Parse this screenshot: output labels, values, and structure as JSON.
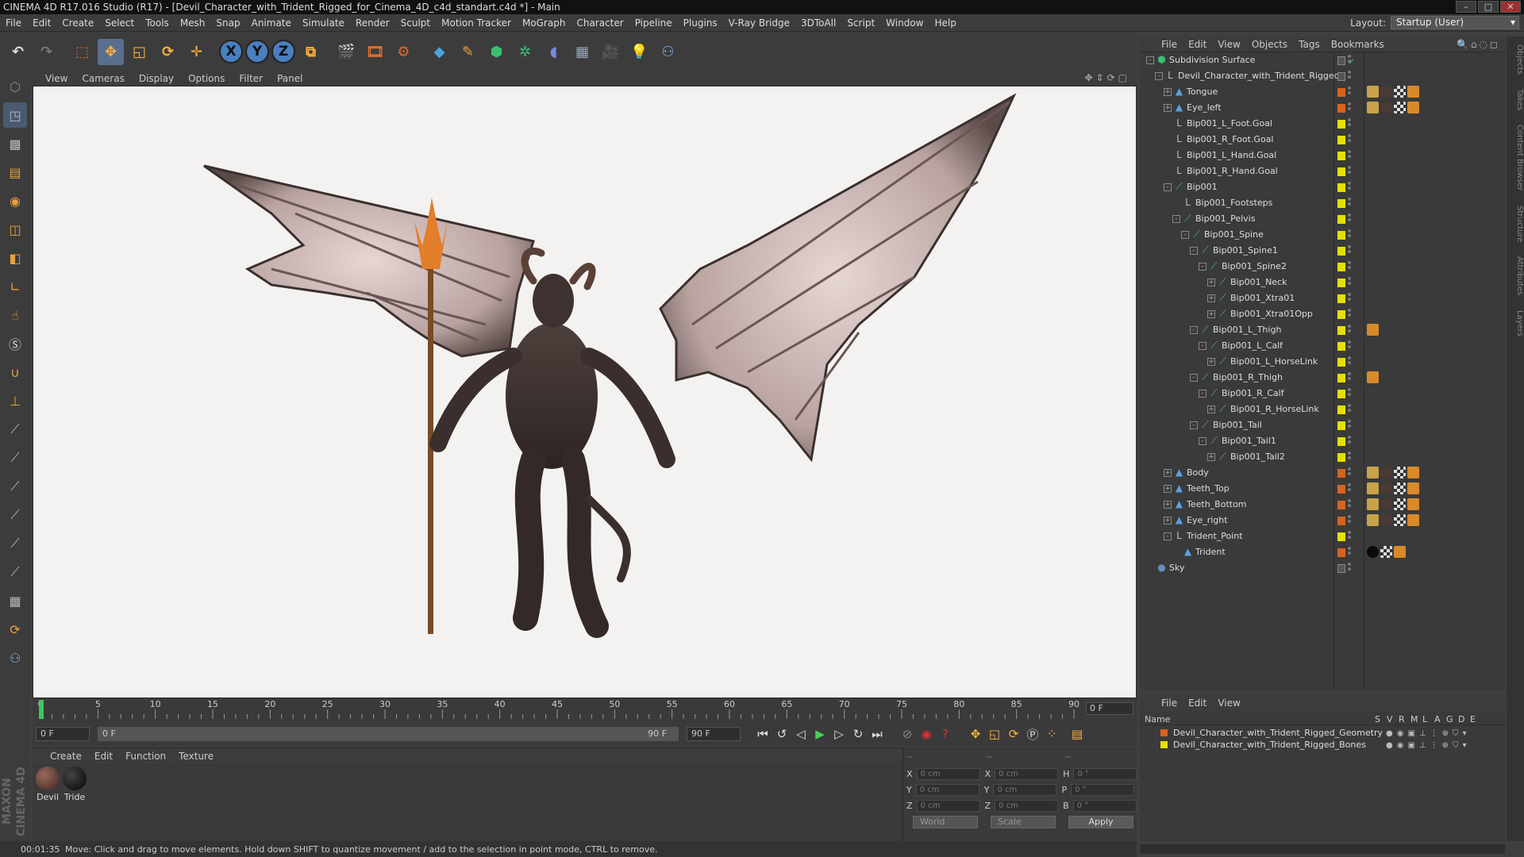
{
  "title": "CINEMA 4D R17.016 Studio (R17) - [Devil_Character_with_Trident_Rigged_for_Cinema_4D_c4d_standart.c4d *] - Main",
  "window_buttons": [
    "–",
    "□",
    "✕"
  ],
  "menu": [
    "File",
    "Edit",
    "Create",
    "Select",
    "Tools",
    "Mesh",
    "Snap",
    "Animate",
    "Simulate",
    "Render",
    "Sculpt",
    "Motion Tracker",
    "MoGraph",
    "Character",
    "Pipeline",
    "Plugins",
    "V-Ray Bridge",
    "3DToAll",
    "Script",
    "Window",
    "Help"
  ],
  "layout": {
    "label": "Layout:",
    "value": "Startup (User)"
  },
  "toolbar_icons": [
    "undo-icon",
    "redo-icon",
    "live-selection-icon",
    "move-icon",
    "scale-icon",
    "rotate-icon",
    "last-tool-icon",
    "x-axis-icon",
    "y-axis-icon",
    "z-axis-icon",
    "coordinate-system-icon",
    "render-view-icon",
    "render-picture-viewer-icon",
    "render-settings-icon",
    "cube-icon",
    "pen-spline-icon",
    "subdivision-icon",
    "array-icon",
    "deformer-icon",
    "floor-icon",
    "camera-icon",
    "light-icon",
    "python-icon"
  ],
  "axis_labels": [
    "X",
    "Y",
    "Z"
  ],
  "viewport_menu": [
    "View",
    "Cameras",
    "Display",
    "Options",
    "Filter",
    "Panel"
  ],
  "timeline": {
    "ticks": [
      "0",
      "5",
      "10",
      "15",
      "20",
      "25",
      "30",
      "35",
      "40",
      "45",
      "50",
      "55",
      "60",
      "65",
      "70",
      "75",
      "80",
      "85",
      "90"
    ],
    "current_frame": "0 F",
    "start_frame": "0 F",
    "range_start": "0 F",
    "range_end": "90 F",
    "end_frame": "90 F"
  },
  "material_menu": [
    "Create",
    "Edit",
    "Function",
    "Texture"
  ],
  "materials": [
    {
      "name": "Devil",
      "color": "#5a3a32"
    },
    {
      "name": "Tride",
      "color": "#0e0e0e"
    }
  ],
  "coords": {
    "headers": [
      "--",
      "--",
      "--"
    ],
    "rows": [
      {
        "a": "X",
        "av": "0 cm",
        "b": "X",
        "bv": "0 cm",
        "c": "H",
        "cv": "0 °"
      },
      {
        "a": "Y",
        "av": "0 cm",
        "b": "Y",
        "bv": "0 cm",
        "c": "P",
        "cv": "0 °"
      },
      {
        "a": "Z",
        "av": "0 cm",
        "b": "Z",
        "bv": "0 cm",
        "c": "B",
        "cv": "0 °"
      }
    ],
    "world": "World",
    "scale": "Scale",
    "apply": "Apply"
  },
  "status": {
    "time": "00:01:35",
    "message": "Move: Click and drag to move elements. Hold down SHIFT to quantize movement / add to the selection in point mode, CTRL to remove."
  },
  "logo": "MAXON CINEMA 4D",
  "object_manager": {
    "menu": [
      "File",
      "Edit",
      "View",
      "Objects",
      "Tags",
      "Bookmarks"
    ],
    "objects": [
      {
        "name": "Subdivision Surface",
        "depth": 0,
        "expand": "-",
        "icon": "subdivision",
        "color": "",
        "tags": [
          "check"
        ]
      },
      {
        "name": "Devil_Character_with_Trident_Rigged",
        "depth": 1,
        "expand": "-",
        "icon": "null",
        "color": "",
        "tags": []
      },
      {
        "name": "Tongue",
        "depth": 2,
        "expand": "+",
        "icon": "polygon",
        "color": "#d9631e",
        "tags": [
          "weight",
          "mat",
          "checker",
          "ik"
        ]
      },
      {
        "name": "Eye_left",
        "depth": 2,
        "expand": "+",
        "icon": "polygon",
        "color": "#d9631e",
        "tags": [
          "weight",
          "mat",
          "checker",
          "ik"
        ]
      },
      {
        "name": "Bip001_L_Foot.Goal",
        "depth": 2,
        "expand": "",
        "icon": "null",
        "color": "#e5e000",
        "tags": []
      },
      {
        "name": "Bip001_R_Foot.Goal",
        "depth": 2,
        "expand": "",
        "icon": "null",
        "color": "#e5e000",
        "tags": []
      },
      {
        "name": "Bip001_L_Hand.Goal",
        "depth": 2,
        "expand": "",
        "icon": "null",
        "color": "#e5e000",
        "tags": []
      },
      {
        "name": "Bip001_R_Hand.Goal",
        "depth": 2,
        "expand": "",
        "icon": "null",
        "color": "#e5e000",
        "tags": []
      },
      {
        "name": "Bip001",
        "depth": 2,
        "expand": "-",
        "icon": "joint",
        "color": "#e5e000",
        "tags": []
      },
      {
        "name": "Bip001_Footsteps",
        "depth": 3,
        "expand": "",
        "icon": "null",
        "color": "#e5e000",
        "tags": []
      },
      {
        "name": "Bip001_Pelvis",
        "depth": 3,
        "expand": "-",
        "icon": "joint",
        "color": "#e5e000",
        "tags": []
      },
      {
        "name": "Bip001_Spine",
        "depth": 4,
        "expand": "-",
        "icon": "joint",
        "color": "#e5e000",
        "tags": []
      },
      {
        "name": "Bip001_Spine1",
        "depth": 5,
        "expand": "-",
        "icon": "joint",
        "color": "#e5e000",
        "tags": []
      },
      {
        "name": "Bip001_Spine2",
        "depth": 6,
        "expand": "-",
        "icon": "joint",
        "color": "#e5e000",
        "tags": []
      },
      {
        "name": "Bip001_Neck",
        "depth": 7,
        "expand": "+",
        "icon": "joint",
        "color": "#e5e000",
        "tags": []
      },
      {
        "name": "Bip001_Xtra01",
        "depth": 7,
        "expand": "+",
        "icon": "joint",
        "color": "#e5e000",
        "tags": []
      },
      {
        "name": "Bip001_Xtra01Opp",
        "depth": 7,
        "expand": "+",
        "icon": "joint",
        "color": "#e5e000",
        "tags": []
      },
      {
        "name": "Bip001_L_Thigh",
        "depth": 5,
        "expand": "-",
        "icon": "joint",
        "color": "#e5e000",
        "tags": [
          "ik"
        ]
      },
      {
        "name": "Bip001_L_Calf",
        "depth": 6,
        "expand": "-",
        "icon": "joint",
        "color": "#e5e000",
        "tags": []
      },
      {
        "name": "Bip001_L_HorseLink",
        "depth": 7,
        "expand": "+",
        "icon": "joint",
        "color": "#e5e000",
        "tags": []
      },
      {
        "name": "Bip001_R_Thigh",
        "depth": 5,
        "expand": "-",
        "icon": "joint",
        "color": "#e5e000",
        "tags": [
          "ik"
        ]
      },
      {
        "name": "Bip001_R_Calf",
        "depth": 6,
        "expand": "-",
        "icon": "joint",
        "color": "#e5e000",
        "tags": []
      },
      {
        "name": "Bip001_R_HorseLink",
        "depth": 7,
        "expand": "+",
        "icon": "joint",
        "color": "#e5e000",
        "tags": []
      },
      {
        "name": "Bip001_Tail",
        "depth": 5,
        "expand": "-",
        "icon": "joint",
        "color": "#e5e000",
        "tags": []
      },
      {
        "name": "Bip001_Tail1",
        "depth": 6,
        "expand": "-",
        "icon": "joint",
        "color": "#e5e000",
        "tags": []
      },
      {
        "name": "Bip001_Tail2",
        "depth": 7,
        "expand": "+",
        "icon": "joint",
        "color": "#e5e000",
        "tags": []
      },
      {
        "name": "Body",
        "depth": 2,
        "expand": "+",
        "icon": "polygon",
        "color": "#d9631e",
        "tags": [
          "weight",
          "mat",
          "checker",
          "ik"
        ]
      },
      {
        "name": "Teeth_Top",
        "depth": 2,
        "expand": "+",
        "icon": "polygon",
        "color": "#d9631e",
        "tags": [
          "weight",
          "mat",
          "checker",
          "ik"
        ]
      },
      {
        "name": "Teeth_Bottom",
        "depth": 2,
        "expand": "+",
        "icon": "polygon",
        "color": "#d9631e",
        "tags": [
          "weight",
          "mat",
          "checker",
          "ik"
        ]
      },
      {
        "name": "Eye_right",
        "depth": 2,
        "expand": "+",
        "icon": "polygon",
        "color": "#d9631e",
        "tags": [
          "weight",
          "mat",
          "checker",
          "ik"
        ]
      },
      {
        "name": "Trident_Point",
        "depth": 2,
        "expand": "-",
        "icon": "null",
        "color": "#e5e000",
        "tags": []
      },
      {
        "name": "Trident",
        "depth": 3,
        "expand": "",
        "icon": "polygon",
        "color": "#d9631e",
        "tags": [
          "black",
          "checker",
          "ik"
        ]
      },
      {
        "name": "Sky",
        "depth": 0,
        "expand": "",
        "icon": "sky",
        "color": "",
        "tags": []
      }
    ]
  },
  "layer_manager": {
    "menu": [
      "File",
      "Edit",
      "View"
    ],
    "columns": [
      "Name",
      "S",
      "V",
      "R",
      "M",
      "L",
      "A",
      "G",
      "D",
      "E"
    ],
    "layers": [
      {
        "name": "Devil_Character_with_Trident_Rigged_Geometry",
        "color": "#d9631e"
      },
      {
        "name": "Devil_Character_with_Trident_Rigged_Bones",
        "color": "#e5e000"
      }
    ]
  },
  "side_tabs": [
    "Objects",
    "Takes",
    "Content Browser",
    "Structure",
    "Attributes",
    "Layers"
  ]
}
